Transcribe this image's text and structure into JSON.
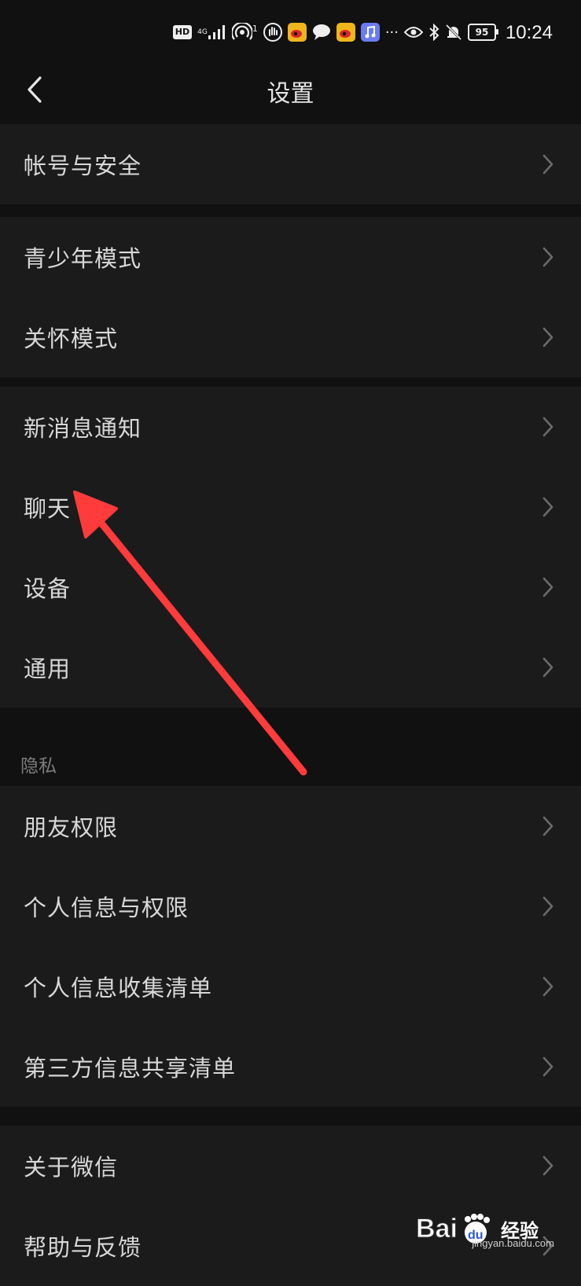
{
  "status_bar": {
    "hd": "HD",
    "network": "4G",
    "hotspot_count": "1",
    "more": "···",
    "battery": "95",
    "time": "10:24",
    "icons": [
      "hd-badge",
      "signal-icon",
      "hotspot-icon",
      "hand-icon",
      "weibo-icon",
      "chat-bubble-icon",
      "weibo-icon",
      "music-app-icon",
      "eye-icon",
      "bluetooth-icon",
      "bell-muted-icon",
      "battery-icon"
    ]
  },
  "header": {
    "title": "设置",
    "back_icon": "chevron-left-icon"
  },
  "groups": [
    {
      "items": [
        {
          "label": "帐号与安全"
        }
      ]
    },
    {
      "items": [
        {
          "label": "青少年模式"
        },
        {
          "label": "关怀模式"
        }
      ]
    },
    {
      "items": [
        {
          "label": "新消息通知"
        },
        {
          "label": "聊天"
        },
        {
          "label": "设备"
        },
        {
          "label": "通用"
        }
      ]
    }
  ],
  "privacy": {
    "section_title": "隐私",
    "items": [
      {
        "label": "朋友权限"
      },
      {
        "label": "个人信息与权限"
      },
      {
        "label": "个人信息收集清单"
      },
      {
        "label": "第三方信息共享清单"
      }
    ]
  },
  "about_group": {
    "items": [
      {
        "label": "关于微信"
      },
      {
        "label": "帮助与反馈"
      }
    ]
  },
  "annotation": {
    "color": "#ff3b3b"
  },
  "watermark": {
    "brand": "Bai",
    "brand2": "du",
    "suffix": "经验",
    "url": "jingyan.baidu.com"
  },
  "colors": {
    "background": "#111111",
    "cell": "#1b1b1b",
    "text": "#d8d8d8",
    "muted": "#7c7c7c"
  }
}
